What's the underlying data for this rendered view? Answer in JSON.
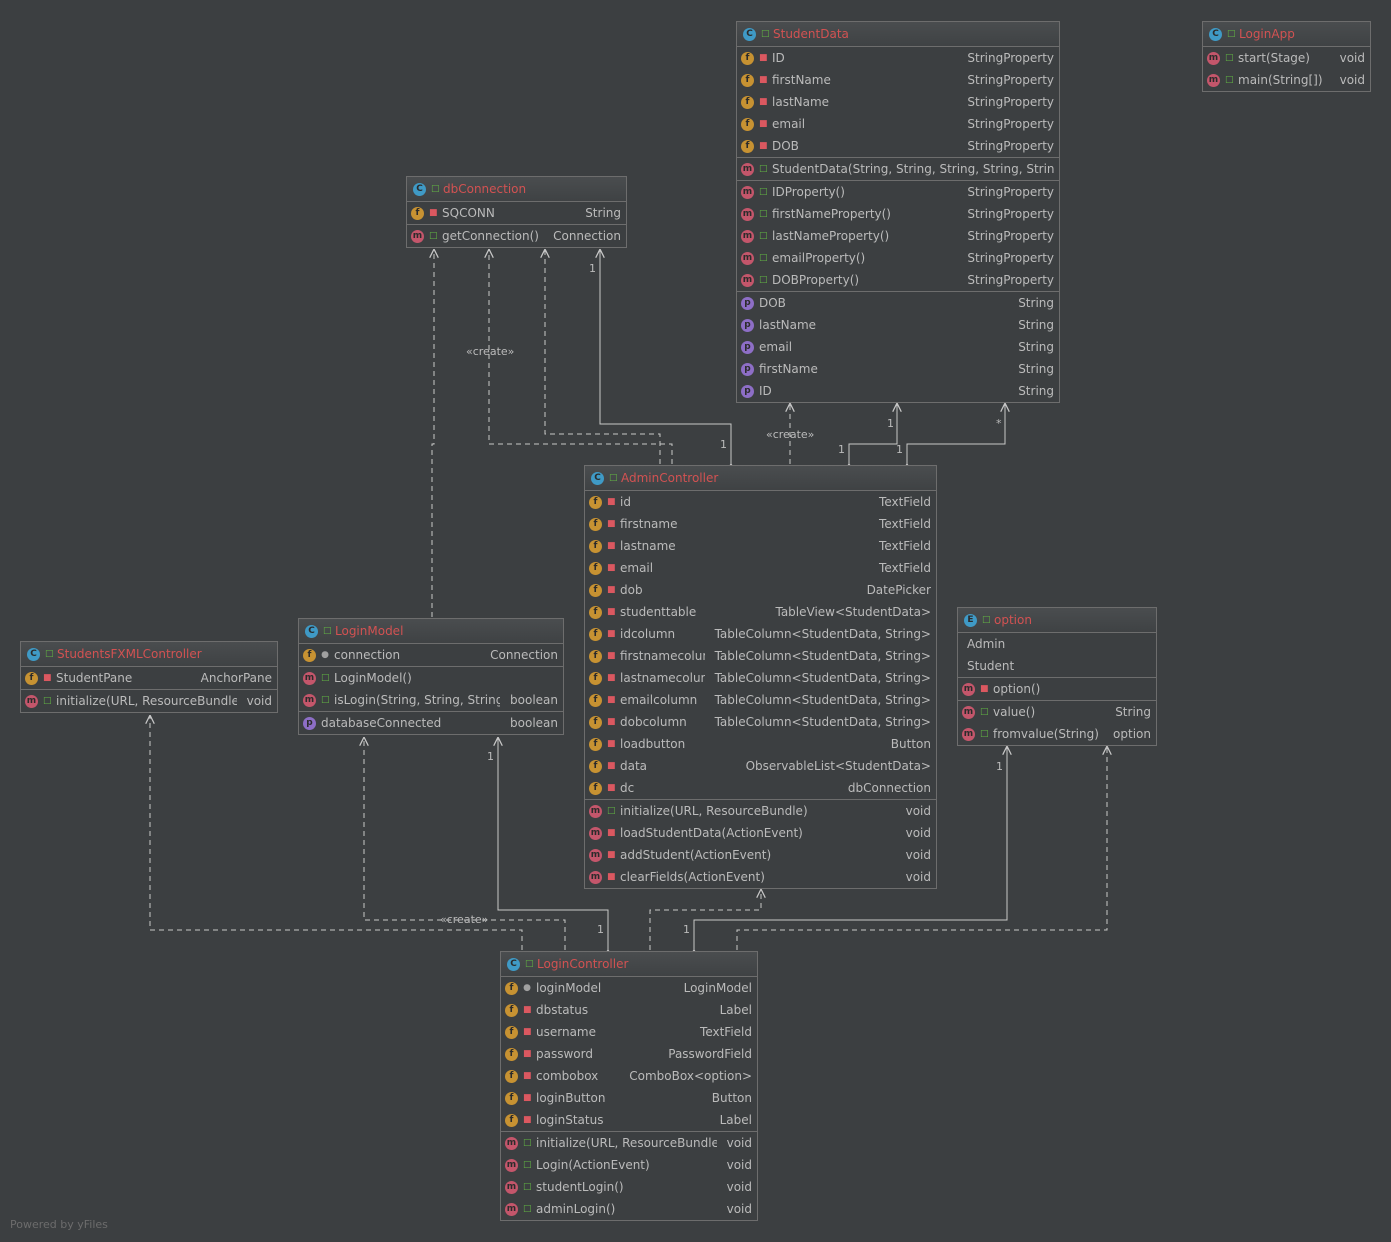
{
  "colors": {
    "background": "#3c3f41",
    "border": "#6d6d6d",
    "title": "#d25252",
    "text": "#bbbbbb",
    "edge": "#c8c8c8"
  },
  "icons": {
    "c": "class-icon",
    "e": "enum-icon",
    "f": "field-icon",
    "m": "method-icon",
    "p": "property-icon",
    "pub": "public-visibility-icon",
    "priv": "private-visibility-icon",
    "pkg": "package-visibility-icon"
  },
  "watermark": "Powered by yFiles",
  "edge_labels": {
    "create_db": "«create»",
    "create_student": "«create»",
    "create_login": "«create»",
    "m_db_1": "1",
    "m_ac_db": "1",
    "m_sd_1": "1",
    "m_ac_sd": "1",
    "m_sd_star": "*",
    "m_ac_sd2": "1",
    "m_lm_1": "1",
    "m_lc_lm": "1",
    "m_lc_opt": "1",
    "m_opt_1": "1"
  },
  "classes": [
    {
      "key": "studentdata",
      "kind": "c",
      "name": "StudentData",
      "sections": [
        [
          {
            "k": "f",
            "v": "priv",
            "n": "ID",
            "t": "StringProperty"
          },
          {
            "k": "f",
            "v": "priv",
            "n": "firstName",
            "t": "StringProperty"
          },
          {
            "k": "f",
            "v": "priv",
            "n": "lastName",
            "t": "StringProperty"
          },
          {
            "k": "f",
            "v": "priv",
            "n": "email",
            "t": "StringProperty"
          },
          {
            "k": "f",
            "v": "priv",
            "n": "DOB",
            "t": "StringProperty"
          }
        ],
        [
          {
            "k": "m",
            "v": "pub",
            "n": "StudentData(String, String, String, String, String)",
            "t": ""
          }
        ],
        [
          {
            "k": "m",
            "v": "pub",
            "n": "IDProperty()",
            "t": "StringProperty"
          },
          {
            "k": "m",
            "v": "pub",
            "n": "firstNameProperty()",
            "t": "StringProperty"
          },
          {
            "k": "m",
            "v": "pub",
            "n": "lastNameProperty()",
            "t": "StringProperty"
          },
          {
            "k": "m",
            "v": "pub",
            "n": "emailProperty()",
            "t": "StringProperty"
          },
          {
            "k": "m",
            "v": "pub",
            "n": "DOBProperty()",
            "t": "StringProperty"
          }
        ],
        [
          {
            "k": "p",
            "v": "",
            "n": "DOB",
            "t": "String"
          },
          {
            "k": "p",
            "v": "",
            "n": "lastName",
            "t": "String"
          },
          {
            "k": "p",
            "v": "",
            "n": "email",
            "t": "String"
          },
          {
            "k": "p",
            "v": "",
            "n": "firstName",
            "t": "String"
          },
          {
            "k": "p",
            "v": "",
            "n": "ID",
            "t": "String"
          }
        ]
      ]
    },
    {
      "key": "loginapp",
      "kind": "c",
      "name": "LoginApp",
      "sections": [
        [
          {
            "k": "m",
            "v": "pub",
            "n": "start(Stage)",
            "t": "void"
          },
          {
            "k": "m",
            "v": "pub",
            "n": "main(String[])",
            "t": "void"
          }
        ]
      ]
    },
    {
      "key": "dbconnection",
      "kind": "c",
      "name": "dbConnection",
      "sections": [
        [
          {
            "k": "f",
            "v": "priv",
            "n": "SQCONN",
            "t": "String"
          }
        ],
        [
          {
            "k": "m",
            "v": "pub",
            "n": "getConnection()",
            "t": "Connection"
          }
        ]
      ]
    },
    {
      "key": "admincontroller",
      "kind": "c",
      "name": "AdminController",
      "sections": [
        [
          {
            "k": "f",
            "v": "priv",
            "n": "id",
            "t": "TextField"
          },
          {
            "k": "f",
            "v": "priv",
            "n": "firstname",
            "t": "TextField"
          },
          {
            "k": "f",
            "v": "priv",
            "n": "lastname",
            "t": "TextField"
          },
          {
            "k": "f",
            "v": "priv",
            "n": "email",
            "t": "TextField"
          },
          {
            "k": "f",
            "v": "priv",
            "n": "dob",
            "t": "DatePicker"
          },
          {
            "k": "f",
            "v": "priv",
            "n": "studenttable",
            "t": "TableView<StudentData>"
          },
          {
            "k": "f",
            "v": "priv",
            "n": "idcolumn",
            "t": "TableColumn<StudentData, String>"
          },
          {
            "k": "f",
            "v": "priv",
            "n": "firstnamecolumn",
            "t": "TableColumn<StudentData, String>"
          },
          {
            "k": "f",
            "v": "priv",
            "n": "lastnamecolumn",
            "t": "TableColumn<StudentData, String>"
          },
          {
            "k": "f",
            "v": "priv",
            "n": "emailcolumn",
            "t": "TableColumn<StudentData, String>"
          },
          {
            "k": "f",
            "v": "priv",
            "n": "dobcolumn",
            "t": "TableColumn<StudentData, String>"
          },
          {
            "k": "f",
            "v": "priv",
            "n": "loadbutton",
            "t": "Button"
          },
          {
            "k": "f",
            "v": "priv",
            "n": "data",
            "t": "ObservableList<StudentData>"
          },
          {
            "k": "f",
            "v": "priv",
            "n": "dc",
            "t": "dbConnection"
          }
        ],
        [
          {
            "k": "m",
            "v": "pub",
            "n": "initialize(URL, ResourceBundle)",
            "t": "void"
          },
          {
            "k": "m",
            "v": "priv",
            "n": "loadStudentData(ActionEvent)",
            "t": "void"
          },
          {
            "k": "m",
            "v": "priv",
            "n": "addStudent(ActionEvent)",
            "t": "void"
          },
          {
            "k": "m",
            "v": "priv",
            "n": "clearFields(ActionEvent)",
            "t": "void"
          }
        ]
      ]
    },
    {
      "key": "option",
      "kind": "e",
      "name": "option",
      "sections": [
        [
          {
            "k": "",
            "v": "",
            "n": "Admin",
            "t": ""
          },
          {
            "k": "",
            "v": "",
            "n": "Student",
            "t": ""
          }
        ],
        [
          {
            "k": "m",
            "v": "priv",
            "n": "option()",
            "t": ""
          }
        ],
        [
          {
            "k": "m",
            "v": "pub",
            "n": "value()",
            "t": "String"
          },
          {
            "k": "m",
            "v": "pub",
            "n": "fromvalue(String)",
            "t": "option"
          }
        ]
      ]
    },
    {
      "key": "studentsfxml",
      "kind": "c",
      "name": "StudentsFXMLController",
      "sections": [
        [
          {
            "k": "f",
            "v": "priv",
            "n": "StudentPane",
            "t": "AnchorPane"
          }
        ],
        [
          {
            "k": "m",
            "v": "pub",
            "n": "initialize(URL, ResourceBundle)",
            "t": "void"
          }
        ]
      ]
    },
    {
      "key": "loginmodel",
      "kind": "c",
      "name": "LoginModel",
      "sections": [
        [
          {
            "k": "f",
            "v": "pkg",
            "n": "connection",
            "t": "Connection"
          }
        ],
        [
          {
            "k": "m",
            "v": "pub",
            "n": "LoginModel()",
            "t": ""
          },
          {
            "k": "m",
            "v": "pub",
            "n": "isLogin(String, String, String)",
            "t": "boolean"
          }
        ],
        [
          {
            "k": "p",
            "v": "",
            "n": "databaseConnected",
            "t": "boolean"
          }
        ]
      ]
    },
    {
      "key": "logincontroller",
      "kind": "c",
      "name": "LoginController",
      "sections": [
        [
          {
            "k": "f",
            "v": "pkg",
            "n": "loginModel",
            "t": "LoginModel"
          },
          {
            "k": "f",
            "v": "priv",
            "n": "dbstatus",
            "t": "Label"
          },
          {
            "k": "f",
            "v": "priv",
            "n": "username",
            "t": "TextField"
          },
          {
            "k": "f",
            "v": "priv",
            "n": "password",
            "t": "PasswordField"
          },
          {
            "k": "f",
            "v": "priv",
            "n": "combobox",
            "t": "ComboBox<option>"
          },
          {
            "k": "f",
            "v": "priv",
            "n": "loginButton",
            "t": "Button"
          },
          {
            "k": "f",
            "v": "priv",
            "n": "loginStatus",
            "t": "Label"
          }
        ],
        [
          {
            "k": "m",
            "v": "pub",
            "n": "initialize(URL, ResourceBundle)",
            "t": "void"
          },
          {
            "k": "m",
            "v": "pub",
            "n": "Login(ActionEvent)",
            "t": "void"
          },
          {
            "k": "m",
            "v": "pub",
            "n": "studentLogin()",
            "t": "void"
          },
          {
            "k": "m",
            "v": "pub",
            "n": "adminLogin()",
            "t": "void"
          }
        ]
      ]
    }
  ]
}
